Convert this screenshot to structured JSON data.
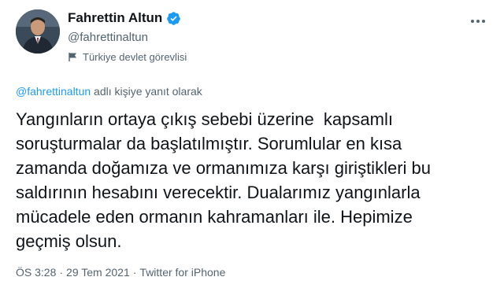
{
  "user": {
    "display_name": "Fahrettin Altun",
    "handle": "@fahrettinaltun",
    "account_label": "Türkiye devlet görevlisi",
    "verified": true,
    "avatar_icon": "profile-photo",
    "verified_color": "#1d9bf0"
  },
  "reply": {
    "mention": "@fahrettinaltun",
    "suffix": " adlı kişiye yanıt olarak"
  },
  "tweet": {
    "lines": [
      "Yangınların ortaya çıkış sebebi üzerine  kapsamlı",
      "soruşturmalar da başlatılmıştır. Sorumlular en kısa",
      "zamanda doğamıza ve ormanımıza karşı giriştikleri bu",
      "saldırının hesabını verecektir. Dualarımız yangınlarla",
      "mücadele eden ormanın kahramanları ile. Hepimize",
      "geçmiş olsun."
    ]
  },
  "meta": {
    "time": "ÖS 3:28",
    "date": "29 Tem 2021",
    "separator": "·",
    "source": "Twitter for iPhone"
  }
}
